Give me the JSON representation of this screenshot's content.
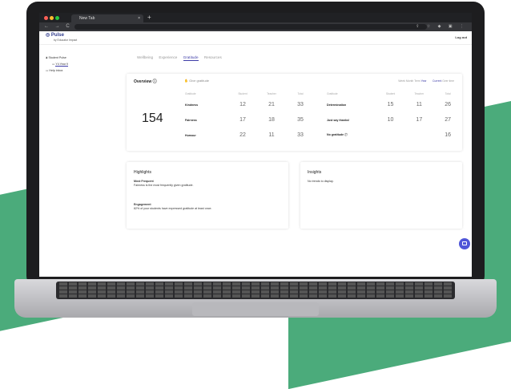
{
  "browser": {
    "tab_title": "New Tab",
    "tab_close": "×",
    "new_tab": "+",
    "nav_buttons": "← → C",
    "toolbar_icons": "⇪ ☆ ◆ ▣ ⋮",
    "colors": {
      "close": "#ff5f57",
      "minimize": "#febc2e",
      "maximize": "#28c840"
    }
  },
  "app": {
    "logo": "Pulse",
    "logo_sub": "by Educator Impact",
    "logout": "Log out"
  },
  "sidebar": {
    "student_pulse": "Student Pulse",
    "year": "Y4 Year 9",
    "help": "Help inbox"
  },
  "tabs": [
    "Wellbeing",
    "Experience",
    "Gratitude",
    "Resources"
  ],
  "overview": {
    "title": "Overview",
    "give": "Give gratitude",
    "periods": [
      "Week",
      "Month",
      "Term",
      "Year"
    ],
    "selected_period": "Year",
    "current": "Current",
    "overtime": "Over time",
    "total": "154",
    "left_headers": [
      "Gratitude",
      "Student",
      "Teacher",
      "Total"
    ],
    "left_rows": [
      {
        "name": "Kindness",
        "student": "12",
        "teacher": "21",
        "total": "33"
      },
      {
        "name": "Fairness",
        "student": "17",
        "teacher": "18",
        "total": "35"
      },
      {
        "name": "Humour",
        "student": "22",
        "teacher": "11",
        "total": "33"
      }
    ],
    "right_headers": [
      "Gratitude",
      "Student",
      "Teacher",
      "Total"
    ],
    "right_rows": [
      {
        "name": "Determination",
        "student": "15",
        "teacher": "11",
        "total": "26"
      },
      {
        "name": "Just say thanks!",
        "student": "10",
        "teacher": "17",
        "total": "27"
      },
      {
        "name": "No gratitude",
        "student": "",
        "teacher": "",
        "total": "16"
      }
    ]
  },
  "highlights": {
    "title": "Highlights",
    "most_frequent_label": "Most Frequent",
    "most_frequent_text": "Fairness is the most frequently given gratitude.",
    "engagement_label": "Engagement",
    "engagement_text": "82% of your students have expressed gratitude at least once."
  },
  "insights": {
    "title": "Insights",
    "text": "No trends to display."
  }
}
